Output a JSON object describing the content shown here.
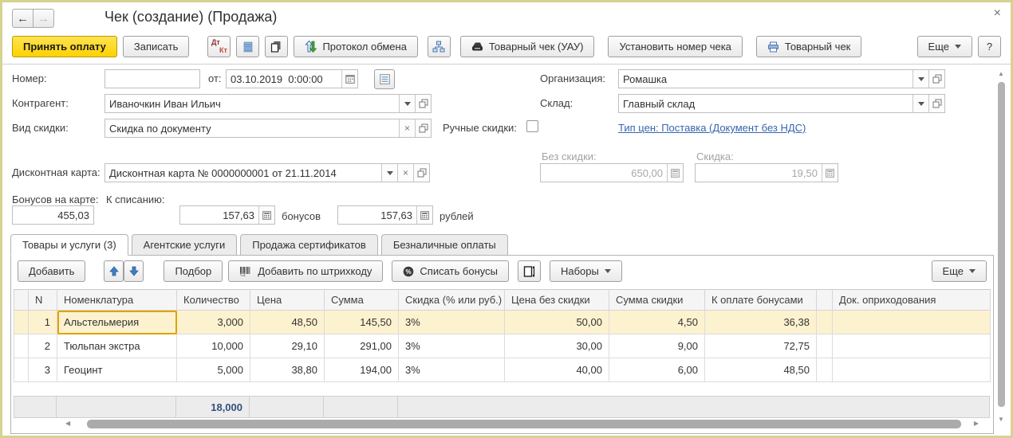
{
  "window": {
    "title": "Чек (создание) (Продажа)"
  },
  "icons": {
    "back": "←",
    "forward": "→",
    "close": "×",
    "dt": "Дт",
    "kt": "Кт",
    "clear": "×",
    "up": "▲",
    "down": "▼",
    "left": "◀",
    "right": "▶"
  },
  "colors": {
    "accent_yellow": "#ffd200",
    "link_blue": "#3566ad",
    "selection_row": "#fcf2cf",
    "focus_border": "#dfa300",
    "frame_olive": "#d6d391"
  },
  "toolbar": {
    "accept": "Принять оплату",
    "write": "Записать",
    "protocol": "Протокол обмена",
    "receipt_uau": "Товарный чек (УАУ)",
    "set_number": "Установить номер чека",
    "receipt": "Товарный чек",
    "more": "Еще",
    "help": "?"
  },
  "form": {
    "number_label": "Номер:",
    "number_value": "",
    "date_label": "от:",
    "date_value": "03.10.2019  0:00:00",
    "org_label": "Организация:",
    "org_value": "Ромашка",
    "counterparty_label": "Контрагент:",
    "counterparty_value": "Иваночкин Иван Ильич",
    "warehouse_label": "Склад:",
    "warehouse_value": "Главный склад",
    "discount_kind_label": "Вид скидки:",
    "discount_kind_value": "Скидка по документу",
    "manual_discounts_label": "Ручные скидки:",
    "price_type_link": "Тип цен: Поставка (Документ без НДС)",
    "discount_card_label": "Дисконтная карта:",
    "discount_card_value": "Дисконтная карта № 0000000001 от 21.11.2014",
    "no_discount_label": "Без скидки:",
    "no_discount_value": "650,00",
    "discount_label": "Скидка:",
    "discount_value": "19,50",
    "bonus_on_card_label": "Бонусов на карте:",
    "bonus_on_card_value": "455,03",
    "to_writeoff_label": "К списанию:",
    "bonus_value": "157,63",
    "bonus_unit": "бонусов",
    "rub_value": "157,63",
    "rub_unit": "рублей"
  },
  "tabs": [
    {
      "label": "Товары и услуги (3)",
      "active": true
    },
    {
      "label": "Агентские услуги",
      "active": false
    },
    {
      "label": "Продажа сертификатов",
      "active": false
    },
    {
      "label": "Безналичные оплаты",
      "active": false
    }
  ],
  "items_toolbar": {
    "add": "Добавить",
    "pick": "Подбор",
    "add_barcode": "Добавить по штрихкоду",
    "writeoff": "Списать бонусы",
    "sets": "Наборы",
    "more": "Еще"
  },
  "table": {
    "columns": [
      "N",
      "Номенклатура",
      "Количество",
      "Цена",
      "Сумма",
      "Скидка (% или руб.)",
      "Цена без скидки",
      "Сумма скидки",
      "К оплате бонусами",
      "Док. оприходования"
    ],
    "rows": [
      {
        "n": "1",
        "nomenclature": "Альстельмерия",
        "qty": "3,000",
        "price": "48,50",
        "sum": "145,50",
        "discount": "3%",
        "price_no_disc": "50,00",
        "disc_sum": "4,50",
        "bonus_pay": "36,38",
        "doc": ""
      },
      {
        "n": "2",
        "nomenclature": "Тюльпан экстра",
        "qty": "10,000",
        "price": "29,10",
        "sum": "291,00",
        "discount": "3%",
        "price_no_disc": "30,00",
        "disc_sum": "9,00",
        "bonus_pay": "72,75",
        "doc": ""
      },
      {
        "n": "3",
        "nomenclature": "Геоцинт",
        "qty": "5,000",
        "price": "38,80",
        "sum": "194,00",
        "discount": "3%",
        "price_no_disc": "40,00",
        "disc_sum": "6,00",
        "bonus_pay": "48,50",
        "doc": ""
      }
    ],
    "footer_qty": "18,000"
  }
}
